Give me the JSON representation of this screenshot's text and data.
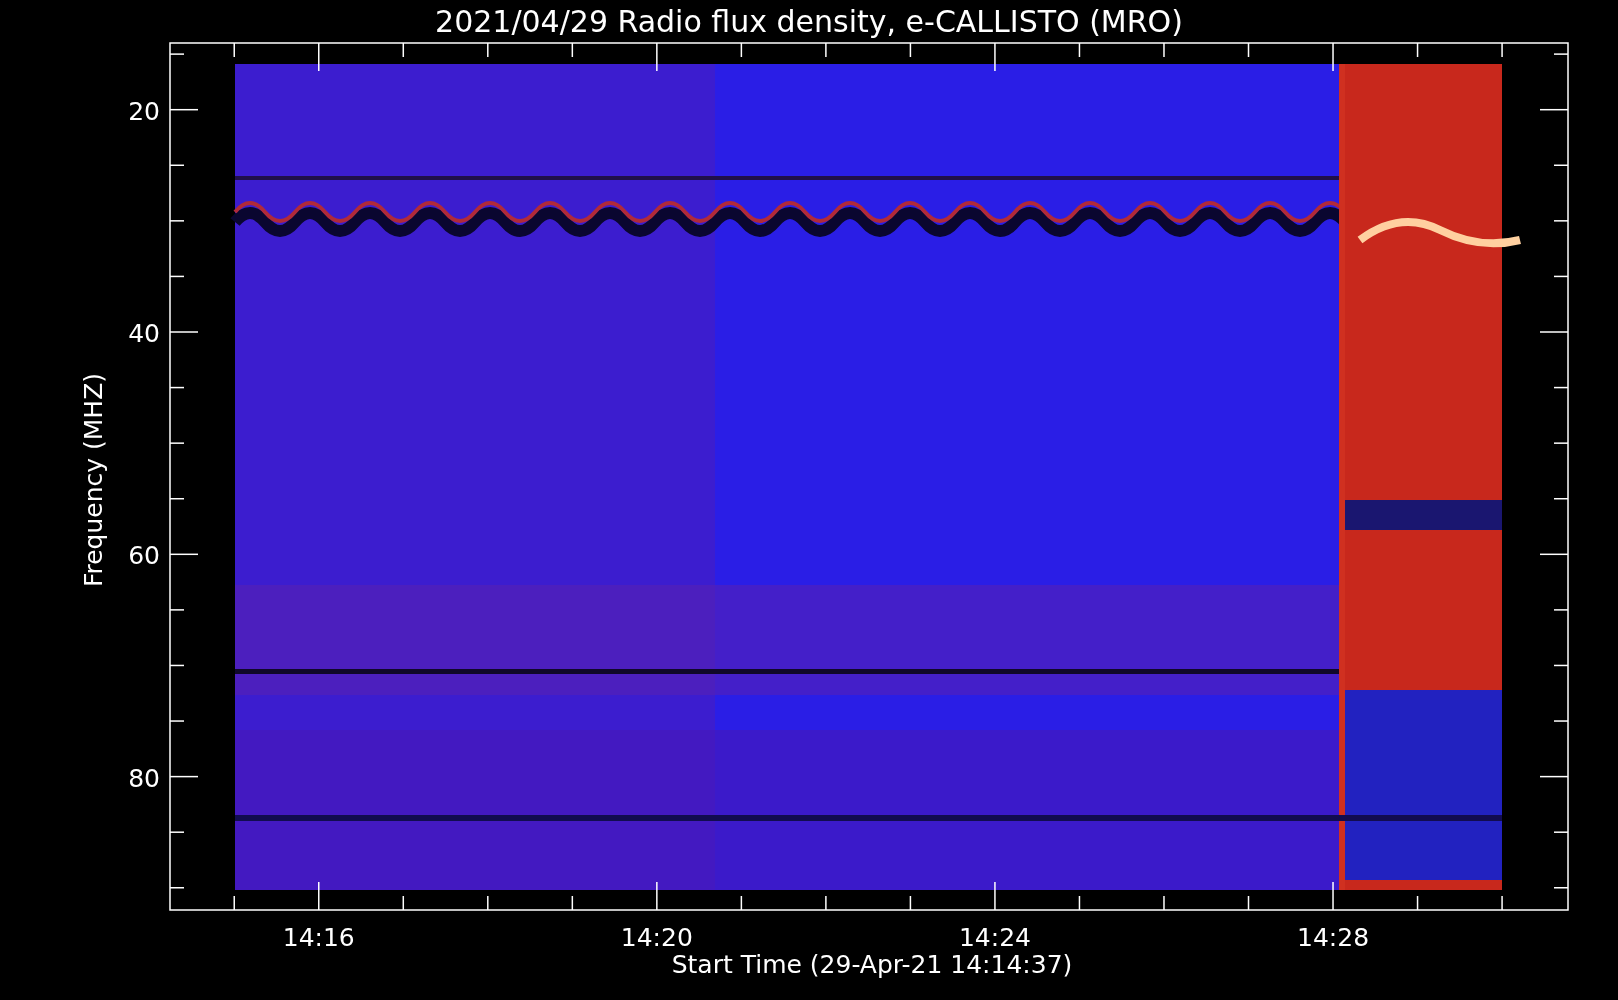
{
  "title": "2021/04/29  Radio flux density, e-CALLISTO (MRO)",
  "plot": {
    "ylabel": "Frequency (MHZ)",
    "xlabel": "Start Time (29-Apr-21 14:14:37)",
    "yticks": [
      "20",
      "40",
      "60",
      "80"
    ],
    "xticks": [
      "14:16",
      "14:20",
      "14:24",
      "14:28"
    ],
    "spectrogram": {
      "kind": "spectrogram"
    }
  }
}
